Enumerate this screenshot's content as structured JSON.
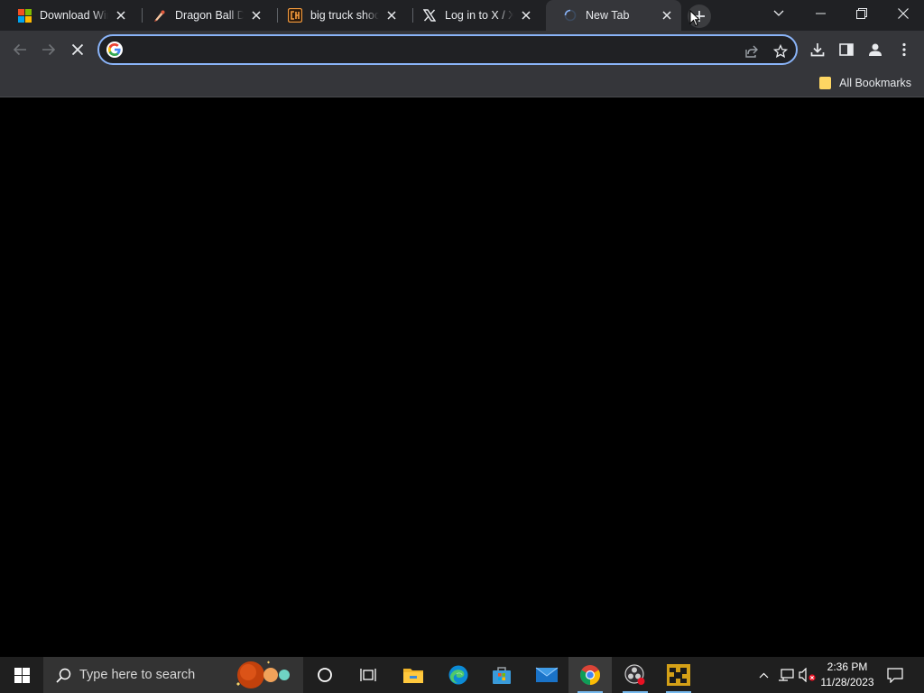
{
  "browser": {
    "tabs": [
      {
        "title": "Download Windows",
        "favicon": "microsoft-logo",
        "active": false
      },
      {
        "title": "Dragon Ball Desktop",
        "favicon": "dragon-ball-icon",
        "active": false
      },
      {
        "title": "big truck shooter",
        "favicon": "crazygames-icon",
        "active": false
      },
      {
        "title": "Log in to X / X",
        "favicon": "x-logo",
        "active": false
      },
      {
        "title": "New Tab",
        "favicon": "loading-spinner",
        "active": true
      }
    ],
    "omnibox": {
      "value": "",
      "placeholder": ""
    },
    "bookmarks": {
      "all_bookmarks_label": "All Bookmarks"
    },
    "colors": {
      "frame": "#202124",
      "toolbar": "#35363a",
      "focus_ring": "#8ab4f8",
      "page": "#000000"
    }
  },
  "taskbar": {
    "search_placeholder": "Type here to search",
    "apps": [
      "cortana",
      "task-view",
      "file-explorer",
      "edge",
      "microsoft-store",
      "mail",
      "chrome",
      "obs-studio",
      "game-app"
    ],
    "clock": {
      "time": "2:36 PM",
      "date": "11/28/2023"
    }
  }
}
